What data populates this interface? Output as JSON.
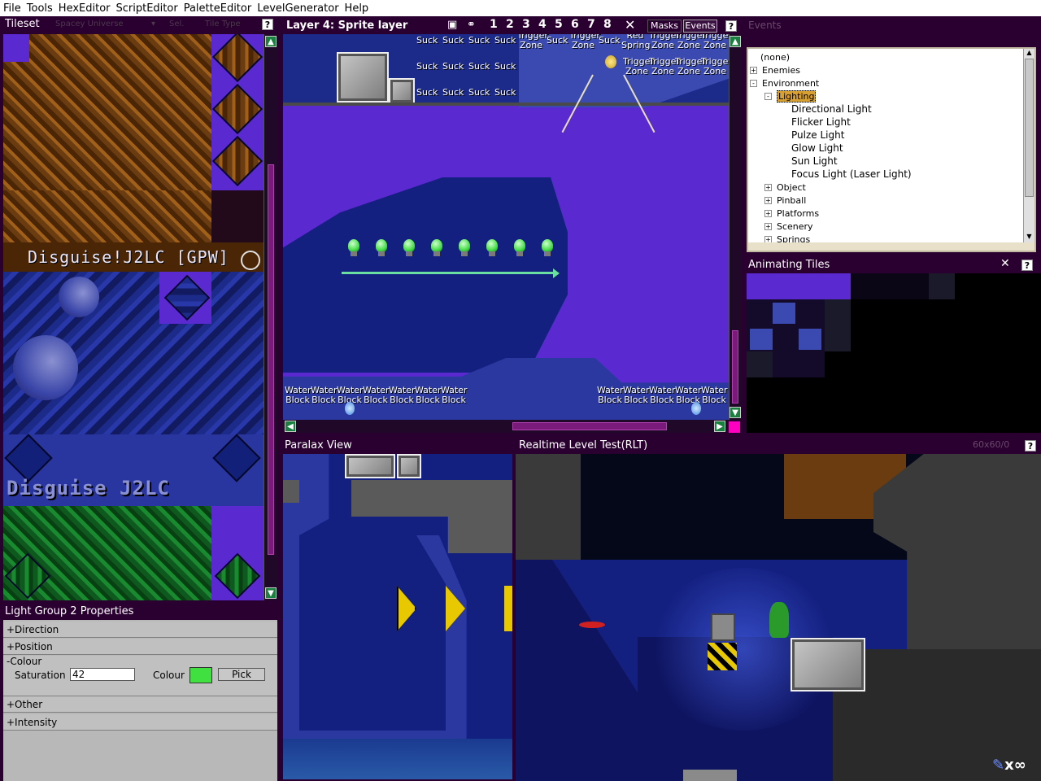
{
  "menu": [
    "File",
    "Tools",
    "HexEditor",
    "ScriptEditor",
    "PaletteEditor",
    "LevelGenerator",
    "Help"
  ],
  "tileset": {
    "title": "Tileset",
    "set_select": "Spacey Universe",
    "sel_label": "Sel.",
    "tile_type": "Tile Type",
    "help": "?",
    "logo_text_1": "Disguise!J2LC [GPW]",
    "logo_text_2": "Disguise J2LC"
  },
  "layer": {
    "title": "Layer 4: Sprite layer",
    "layer_numbers": [
      "1",
      "2",
      "3",
      "4",
      "5",
      "6",
      "7",
      "8"
    ],
    "masks": "Masks",
    "events": "Events",
    "help": "?",
    "suck": "Suck",
    "trigger_zone": "Trigger Zone",
    "red_spring": "Red Spring",
    "water_block": "Water Block"
  },
  "events_panel": {
    "title": "Events",
    "items": [
      {
        "label": "(none)",
        "level": 0,
        "expander": ""
      },
      {
        "label": "Enemies",
        "level": 0,
        "expander": "+"
      },
      {
        "label": "Environment",
        "level": 0,
        "expander": "-"
      },
      {
        "label": "Lighting",
        "level": 1,
        "expander": "-",
        "selected": true
      },
      {
        "label": "Directional Light",
        "level": 2,
        "expander": ""
      },
      {
        "label": "Flicker Light",
        "level": 2,
        "expander": ""
      },
      {
        "label": "Pulze Light",
        "level": 2,
        "expander": ""
      },
      {
        "label": "Glow Light",
        "level": 2,
        "expander": ""
      },
      {
        "label": "Sun Light",
        "level": 2,
        "expander": ""
      },
      {
        "label": "Focus Light (Laser Light)",
        "level": 2,
        "expander": ""
      },
      {
        "label": "Object",
        "level": 1,
        "expander": "+"
      },
      {
        "label": "Pinball",
        "level": 1,
        "expander": "+"
      },
      {
        "label": "Platforms",
        "level": 1,
        "expander": "+"
      },
      {
        "label": "Scenery",
        "level": 1,
        "expander": "+"
      },
      {
        "label": "Springs",
        "level": 1,
        "expander": "+"
      }
    ]
  },
  "animating": {
    "title": "Animating Tiles",
    "help": "?"
  },
  "light_props": {
    "title": "Light Group 2 Properties",
    "direction": "+Direction",
    "position": "+Position",
    "colour_section": "-Colour",
    "saturation_label": "Saturation",
    "saturation_value": "42",
    "colour_label": "Colour",
    "colour_value": "#40e040",
    "pick_button": "Pick",
    "other": "+Other",
    "intensity": "+Intensity"
  },
  "paralax": {
    "title": "Paralax View"
  },
  "rlt": {
    "title": "Realtime Level Test(RLT)",
    "fps": "60x60/0",
    "help": "?",
    "lives": "x∞"
  },
  "colors": {
    "panel_title": "#2a0030",
    "accent": "#7a1a7a",
    "bg_purple": "#5a2ad0",
    "bg_blue": "#1a2a8a"
  }
}
